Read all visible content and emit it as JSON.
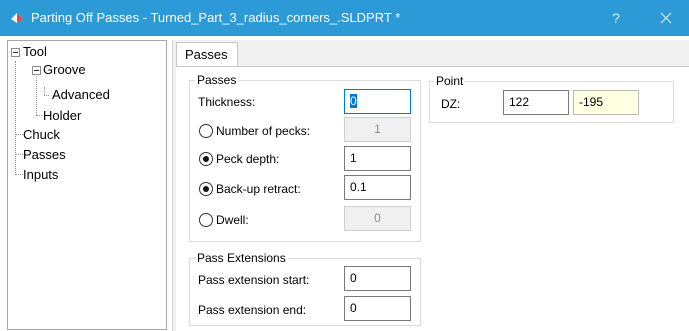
{
  "window": {
    "title": "Parting Off Passes - Turned_Part_3_radius_corners_.SLDPRT *",
    "help_label": "?",
    "accent_color": "#2b9ad6"
  },
  "tree": {
    "items": [
      {
        "label": "Tool"
      },
      {
        "label": "Groove"
      },
      {
        "label": "Advanced"
      },
      {
        "label": "Holder"
      },
      {
        "label": "Chuck"
      },
      {
        "label": "Passes"
      },
      {
        "label": "Inputs"
      }
    ]
  },
  "tabs": [
    {
      "label": "Passes"
    }
  ],
  "passes_group": {
    "title": "Passes",
    "thickness": {
      "label": "Thickness:",
      "value": "0"
    },
    "pecks": {
      "label": "Number of pecks:",
      "value": "1",
      "selected": false
    },
    "peck_depth": {
      "label": "Peck depth:",
      "value": "1",
      "selected": true
    },
    "backup_retract": {
      "label": "Back-up retract:",
      "value": "0.1",
      "selected": true
    },
    "dwell": {
      "label": "Dwell:",
      "value": "0",
      "selected": false
    }
  },
  "point_group": {
    "title": "Point",
    "dz": {
      "label": "DZ:",
      "value1": "122",
      "value2": "-195"
    }
  },
  "extensions_group": {
    "title": "Pass Extensions",
    "start": {
      "label": "Pass extension start:",
      "value": "0"
    },
    "end": {
      "label": "Pass extension end:",
      "value": "0"
    }
  }
}
